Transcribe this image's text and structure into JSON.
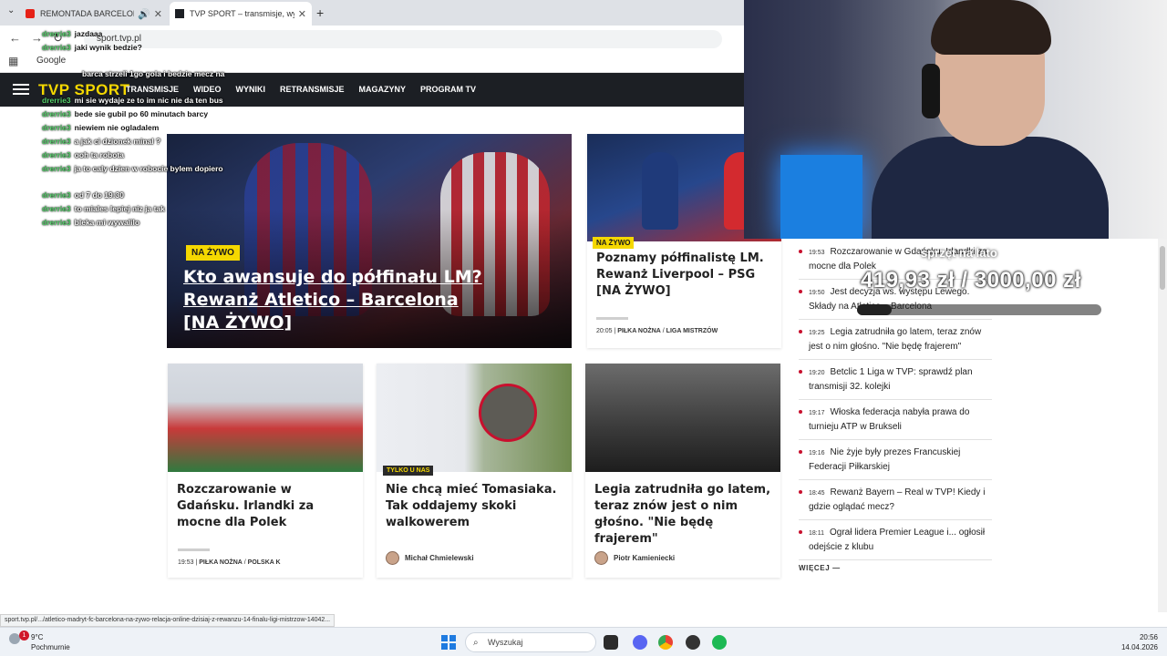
{
  "browser": {
    "tabs": [
      {
        "label": "REMONTADA BARCELONY",
        "active": false
      },
      {
        "label": "TVP SPORT – transmisje, wyniki",
        "active": true
      }
    ],
    "url": "sport.tvp.pl",
    "bookmark": "Google"
  },
  "nav": {
    "logo": "TVP SPORT",
    "items": [
      "TRANSMISJE",
      "WIDEO",
      "WYNIKI",
      "RETRANSMISJE",
      "MAGAZYNY",
      "PROGRAM TV"
    ]
  },
  "hero": {
    "badge": "NA ŻYWO",
    "title": "Kto awansuje do półfinału LM? Rewanż Atletico – Barcelona [NA ŻYWO]"
  },
  "feature": {
    "badge": "NA ŻYWO",
    "title": "Poznamy półfinalistę LM. Rewanż Liverpool – PSG [NA ŻYWO]",
    "time": "20:05",
    "category": "PIŁKA NOŻNA",
    "subcategory": "LIGA MISTRZÓW"
  },
  "cards": [
    {
      "title": "Rozczarowanie w Gdańsku. Irlandki za mocne dla Polek",
      "time": "19:53",
      "category": "PIŁKA NOŻNA",
      "subcategory": "POLSKA K"
    },
    {
      "title": "Nie chcą mieć Tomasiaka. Tak oddajemy skoki walkowerem",
      "badge": "TYLKO U NAS",
      "author": "Michał Chmielewski"
    },
    {
      "title": "Legia zatrudniła go latem, teraz znów jest o nim głośno. \"Nie będę frajerem\"",
      "author": "Piotr Kamieniecki"
    }
  ],
  "latest": [
    {
      "time": "19:53",
      "text": "Rozczarowanie w Gdańsku. Irlandki za mocne dla Polek"
    },
    {
      "time": "19:50",
      "text": "Jest decyzja ws. występu Lewego. Składy na Atletico – Barcelona"
    },
    {
      "time": "19:25",
      "text": "Legia zatrudniła go latem, teraz znów jest o nim głośno. \"Nie będę frajerem\""
    },
    {
      "time": "19:20",
      "text": "Betclic 1 Liga w TVP: sprawdź plan transmisji 32. kolejki"
    },
    {
      "time": "19:17",
      "text": "Włoska federacja nabyła prawa do turnieju ATP w Brukseli"
    },
    {
      "time": "19:16",
      "text": "Nie żyje były prezes Francuskiej Federacji Piłkarskiej"
    },
    {
      "time": "18:45",
      "text": "Rewanż Bayern – Real w TVP! Kiedy i gdzie oglądać mecz?"
    },
    {
      "time": "18:11",
      "text": "Ograł lidera Premier League i... ogłosił odejście z klubu"
    }
  ],
  "more_label": "WIĘCEJ",
  "status_url": "sport.tvp.pl/.../atletico-madryt-fc-barcelona-na-zywo-relacja-online-dzisiaj-z-rewanzu-14-finalu-ligi-mistrzow-14042...",
  "taskbar": {
    "temperature": "9°C",
    "weather": "Pochmurnie",
    "weather_badge": "1",
    "search_placeholder": "Wyszukaj",
    "time": "20:56",
    "date": "14.04.2026"
  },
  "chat": [
    {
      "user": "drerrie3",
      "message": "jazdaaa"
    },
    {
      "user": "drerrie3",
      "message": "jaki wynik bedzie?"
    },
    {
      "user": "drerrie3",
      "message": "barca strzeli 1go gola i bedzie mecz na"
    },
    {
      "user": "drerrie3",
      "message": "mi sie wydaje ze to im nic nie da ten bus"
    },
    {
      "user": "drerrie3",
      "message": "bede sie gubil po 60 minutach barcy"
    },
    {
      "user": "drerrie3",
      "message": "niewiem nie ogladalem"
    },
    {
      "user": "drerrie3",
      "message": "a jak ci dzionek minal ?"
    },
    {
      "user": "drerrie3",
      "message": "ooh ta robota"
    },
    {
      "user": "drerrie3",
      "message": "ja to caly dzien w robocie bylem dopiero"
    },
    {
      "user": "drerrie3",
      "message": "od 7 do 19:30"
    },
    {
      "user": "drerrie3",
      "message": "to miales lepiej niz ja tak"
    },
    {
      "user": "drerrie3",
      "message": "bleka mi wywalilo"
    }
  ],
  "donation": {
    "title": "sprzęt na lato",
    "amount": "419,93 zł / 3000,00 zł",
    "progress": 0.14
  },
  "colors": {
    "brand_yellow": "#f5d800",
    "nav_bg": "#1c1f24",
    "live_dot": "#c8102e"
  }
}
